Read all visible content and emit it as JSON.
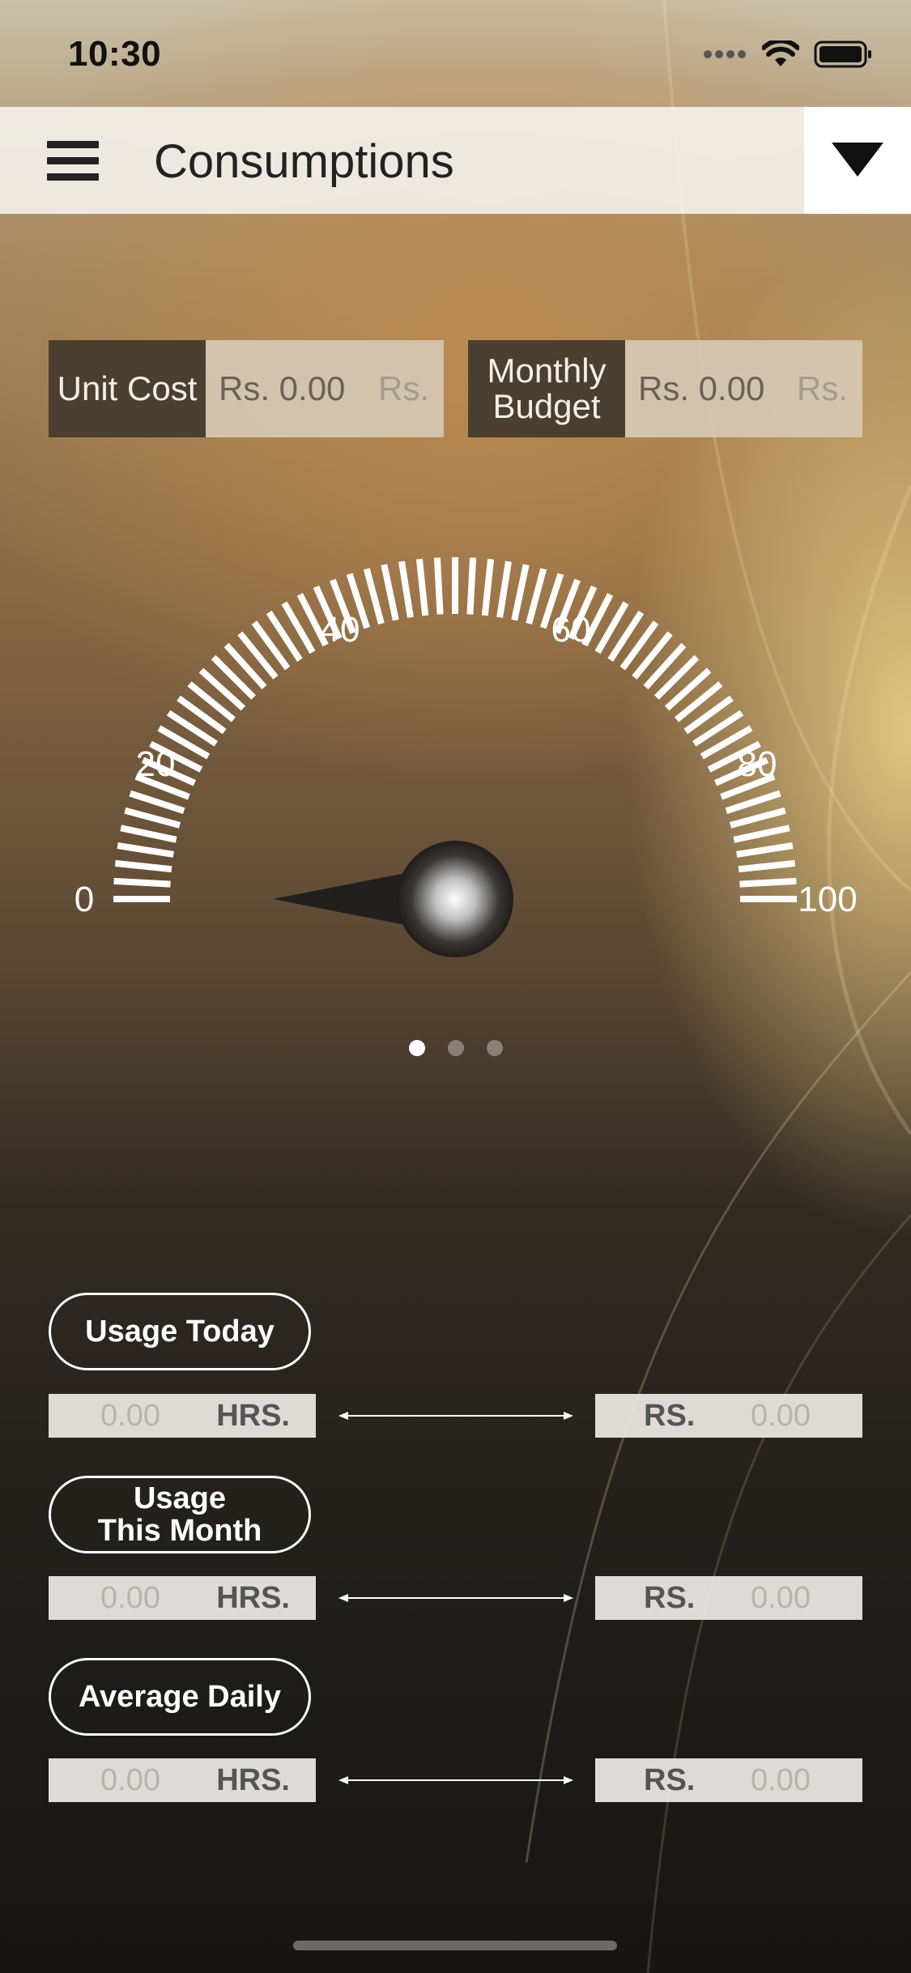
{
  "status_bar": {
    "time": "10:30"
  },
  "header": {
    "title": "Consumptions"
  },
  "unit_cost": {
    "label": "Unit Cost",
    "value": "Rs. 0.00",
    "currency": "Rs."
  },
  "monthly_budget": {
    "label_line1": "Monthly",
    "label_line2": "Budget",
    "value": "Rs. 0.00",
    "currency": "Rs."
  },
  "gauge": {
    "min": 0,
    "max": 100,
    "value": 0,
    "labels": [
      "0",
      "20",
      "40",
      "60",
      "80",
      "100"
    ]
  },
  "pager": {
    "pages": 3,
    "active": 0
  },
  "usage": [
    {
      "title_line1": "Usage Today",
      "title_line2": "",
      "hours": "0.00",
      "hours_unit": "HRS.",
      "cost_unit": "RS.",
      "cost": "0.00"
    },
    {
      "title_line1": "Usage",
      "title_line2": "This Month",
      "hours": "0.00",
      "hours_unit": "HRS.",
      "cost_unit": "RS.",
      "cost": "0.00"
    },
    {
      "title_line1": "Average Daily",
      "title_line2": "",
      "hours": "0.00",
      "hours_unit": "HRS.",
      "cost_unit": "RS.",
      "cost": "0.00"
    }
  ],
  "colors": {
    "label_bg": "#4b3f2f",
    "navbar_bg": "#f2f0ea",
    "accent": "#ffffff"
  }
}
